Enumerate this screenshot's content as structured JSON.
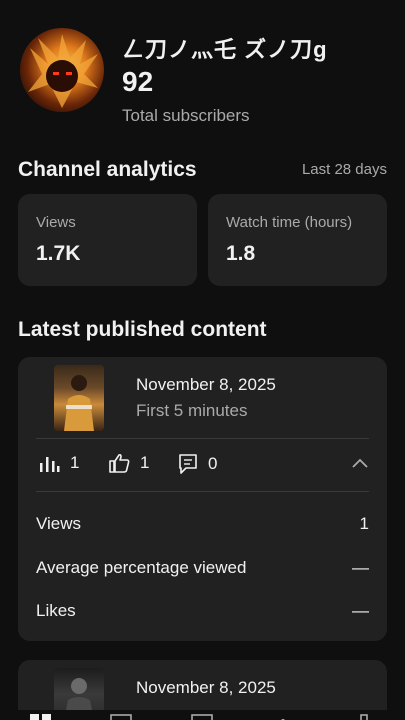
{
  "channel": {
    "name": "ㄥ刀ノ灬乇 ズノ刀g",
    "subscribers": "92",
    "subscribers_label": "Total subscribers"
  },
  "analytics": {
    "title": "Channel analytics",
    "range": "Last 28 days",
    "metrics": [
      {
        "label": "Views",
        "value": "1.7K"
      },
      {
        "label": "Watch time (hours)",
        "value": "1.8"
      }
    ]
  },
  "latest": {
    "title": "Latest published content",
    "items": [
      {
        "date": "November 8, 2025",
        "period": "First 5 minutes",
        "views_count": "1",
        "likes_count": "1",
        "comments_count": "0",
        "rows": [
          {
            "label": "Views",
            "value": "1"
          },
          {
            "label": "Average percentage viewed",
            "value": "—"
          },
          {
            "label": "Likes",
            "value": "—"
          }
        ]
      },
      {
        "date": "November 8, 2025"
      }
    ]
  },
  "icons": {
    "views": "bar-chart-icon",
    "likes": "thumbs-up-icon",
    "comments": "comment-icon",
    "collapse": "chevron-up-icon"
  },
  "colors": {
    "background": "#0f0f0f",
    "card": "#212121",
    "secondary_text": "#aaaaaa"
  }
}
